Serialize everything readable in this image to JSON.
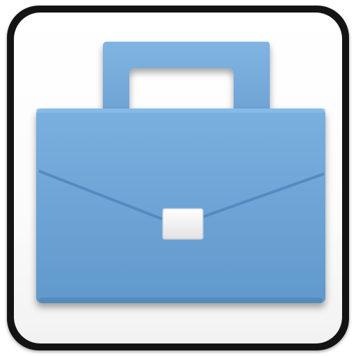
{
  "icon": {
    "name": "briefcase-icon",
    "colors": {
      "tile_border": "#141414",
      "tile_face": "#ffffff",
      "briefcase_body": "#6fa6d6",
      "briefcase_body_dark": "#5b94c8",
      "briefcase_flap_line": "#4f86bb",
      "clasp": "#f2f2f2"
    }
  }
}
